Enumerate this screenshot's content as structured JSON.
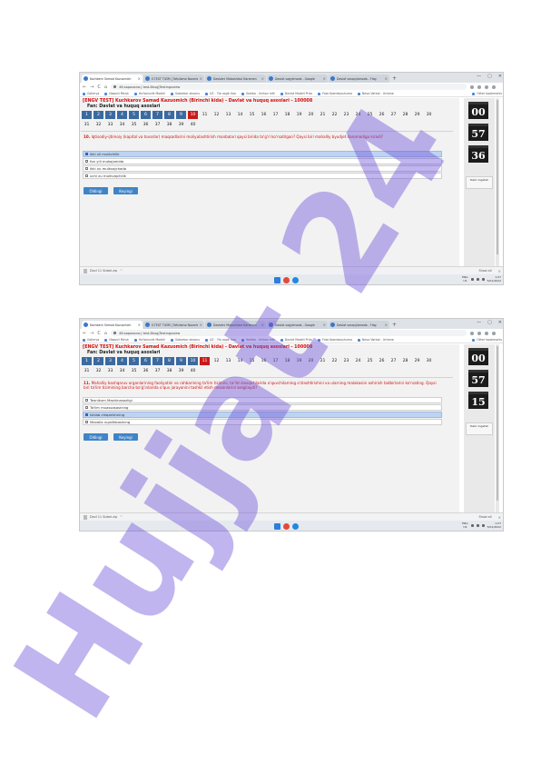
{
  "browser": {
    "tabs": [
      "Kochbern Semad Kazuomich",
      "E-TEST TIZIM | Tafsilamo Nazarlar",
      "Davlatni Moboshlavi Karamen",
      "Davlat vagytmoda - Google",
      "Davlat vasqujiamoda - Flag",
      "Davlat vasqujiamoda - Flag"
    ],
    "url": "46.sapaxono.|  test.8kug|Testingsview",
    "bookmarks": [
      "Gallerya",
      "Nasosli Minsk",
      "Ho'boluvlik Modeli",
      "Sabarbor aksanu",
      "UZ - 7to xogit Xoa",
      "Vorkbo - Vnikov mfk",
      "Davlat Modeli Prizs",
      "Foto Kosmkoyshuma",
      "Nessi Varbal - Uchene"
    ],
    "other_bookmarks": "Other bookmarks",
    "window_controls": [
      "—",
      "▢",
      "✕"
    ],
    "nav": [
      "←",
      "→",
      "C",
      "⌂"
    ]
  },
  "exam": {
    "header": "[ENGV TEST]   Kuchkarov Samad Kazuomich (Birinchi kida) - Davlat va huquq asoslari - 100008",
    "subject": "Fan:  Davlat va huquq asoslari",
    "rows": [
      [
        "1",
        "2",
        "3",
        "4",
        "5",
        "6",
        "7",
        "8",
        "9",
        "10",
        "11",
        "12",
        "13",
        "14",
        "15",
        "16",
        "17",
        "18",
        "19",
        "20",
        "21",
        "22",
        "23",
        "24",
        "25",
        "26",
        "27",
        "28",
        "29",
        "30"
      ],
      [
        "31",
        "32",
        "33",
        "34",
        "35",
        "36",
        "37",
        "38",
        "39",
        "40"
      ]
    ],
    "next_label": "Keyingi"
  },
  "shots": [
    {
      "answered_upto": 9,
      "current": 10,
      "question_number": "10.",
      "question": "Iqtisodiy-ijtimoiy (kapital va tovarlar) maqsadlarini moliyalashtirish manbalari qaysi birida to'g'ri ko'rsatilgan? Qaysi biri mahalliy byudjet daromadiga kiradi?",
      "options": [
        "ikki xil mulkchilik",
        "fon yili mukojamida",
        "ikki xu mulkvajchada",
        "uchi xu mulkvajchilik"
      ],
      "selected": 0,
      "prev_label": "Oldingi",
      "timers": [
        "00",
        "57",
        "36"
      ]
    },
    {
      "answered_upto": 10,
      "current": 11,
      "question_number": "11.",
      "question": "Mahalliy boshqaruv organlarining faoliyatini va rahbarining ta'lim tizimini, ta'lim bosqichlarida o'quvchilarning o'zlashtirishini va ularning malakasini oshirish tadbirlarini ko'rsating. Qaysi biri ta'lim tizimining barcha bo'g'inlarida o'quv jarayonini tashkil etish mezonlarini belgilaydi?",
      "options": [
        "Texnikum Mashinasozligi",
        "Ta'lim muassasasining",
        "Ishlab chiqarishning",
        "Maxalla xujalikbasining"
      ],
      "selected": 2,
      "prev_label": "Oldingi",
      "timers": [
        "00",
        "57",
        "15"
      ]
    }
  ],
  "finish_label": "Testni tugatish",
  "downloads": {
    "file": "Davl 11 Sizbel.zip",
    "show_all": "Show all"
  },
  "taskbar": {
    "lang_top": "ENG",
    "lang_bottom": "US",
    "time": "1:07",
    "date": "5/01/2022"
  },
  "watermark": {
    "text": "Hujjat 24",
    "color": "#6b4fd8"
  }
}
